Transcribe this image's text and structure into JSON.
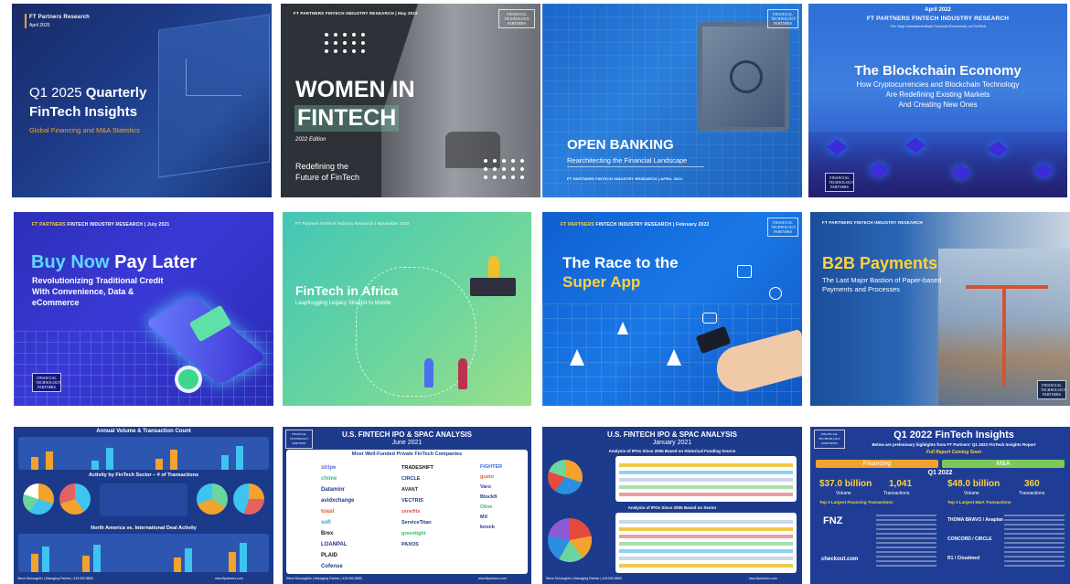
{
  "tiles": [
    {
      "id": "q1-2025",
      "super": "FT Partners Research",
      "date": "April 2025",
      "title_light": "Q1 2025 ",
      "title_bold": "Quarterly",
      "title_line2": "FinTech Insights",
      "subtitle": "Global Financing and M&A Statistics"
    },
    {
      "id": "women-in-fintech",
      "super": "FT PARTNERS FINTECH INDUSTRY RESEARCH | May 2022",
      "title_line1": "WOMEN IN",
      "title_line2": "FINTECH",
      "edition": "2022 Edition",
      "tagline_line1": "Redefining the",
      "tagline_line2": "Future of FinTech",
      "logo": "FINANCIAL TECHNOLOGY PARTNERS"
    },
    {
      "id": "open-banking",
      "title": "OPEN BANKING",
      "subtitle": "Rearchitecting the Financial Landscape",
      "footer": "FT PARTNERS FINTECH INDUSTRY RESEARCH | APRIL 2021",
      "logo": "FINANCIAL TECHNOLOGY PARTNERS"
    },
    {
      "id": "blockchain-economy",
      "date": "April 2022",
      "super": "FT PARTNERS FINTECH INDUSTRY RESEARCH",
      "super_sub": "The Only Investment Bank Focused Exclusively on FinTech",
      "title": "The Blockchain Economy",
      "subtitle_line1": "How Cryptocurrencies and Blockchain Technology",
      "subtitle_line2": "Are Redefining Existing Markets",
      "subtitle_line3": "And Creating New Ones",
      "logo": "FINANCIAL TECHNOLOGY PARTNERS"
    },
    {
      "id": "bnpl",
      "super_accent": "FT PARTNERS",
      "super": " FINTECH INDUSTRY RESEARCH | July 2021",
      "title_word1": "Buy Now ",
      "title_word2": "Pay Later",
      "subtitle_line1": "Revolutionizing Traditional Credit",
      "subtitle_line2": "With Convenience, Data &",
      "subtitle_line3": "eCommerce",
      "logo": "FINANCIAL TECHNOLOGY PARTNERS"
    },
    {
      "id": "fintech-africa",
      "super": "FT Partners FinTech Industry Research | November 2019",
      "title": "FinTech in Africa",
      "subtitle": "Leapfrogging Legacy Straight to Mobile"
    },
    {
      "id": "super-app",
      "super_accent": "FT PARTNERS",
      "super": " FINTECH INDUSTRY RESEARCH | February 2022",
      "title_line1": "The Race to the",
      "title_line2": "Super App",
      "logo": "FINANCIAL TECHNOLOGY PARTNERS"
    },
    {
      "id": "b2b-payments",
      "super": "FT PARTNERS FINTECH INDUSTRY RESEARCH",
      "title": "B2B Payments",
      "subtitle_line1": "The Last Major Bastion of Paper-based",
      "subtitle_line2": "Payments and Processes",
      "logo": "FINANCIAL TECHNOLOGY PARTNERS"
    },
    {
      "id": "volume-count",
      "title": "Annual Volume & Transaction Count",
      "section1": "Activity by FinTech Sector – # of Transactions",
      "section2": "North America vs. International Deal Activity",
      "footer_left": "Steve McLaughlin | Managing Partner | 415.992.8880",
      "footer_right": "www.ftpartners.com"
    },
    {
      "id": "ipo-spac-june",
      "title": "U.S. FINTECH IPO & SPAC ANALYSIS",
      "date": "June 2021",
      "subtitle": "Most Well-Funded Private FinTech Companies",
      "col1": [
        "stripe",
        "chime",
        "Dataminr",
        "avidxchange",
        "toast",
        "sofi",
        "Brex",
        "LOANPAL",
        "PLAID",
        "Cofense"
      ],
      "col2": [
        "TRADESHIFT",
        "CIRCLE",
        "",
        "AVANT",
        "VECTRIS",
        "zenefits",
        "ServiceTitan",
        "",
        "greenlight",
        "PAXOS"
      ],
      "col3": [
        "FIGHTER",
        "gusto",
        "",
        "Varo",
        "",
        "",
        "Blockfi",
        "",
        "Olive",
        "MX",
        "knock"
      ],
      "footer_left": "Steve McLaughlin | Managing Partner | 415.992.8880",
      "footer_right": "www.ftpartners.com"
    },
    {
      "id": "ipo-spac-jan",
      "title": "U.S. FINTECH IPO & SPAC ANALYSIS",
      "date": "January 2021",
      "section1": "Analysis of IPOs Since 2005 Based on Historical Funding Source",
      "section2": "Analysis of IPOs Since 2005 Based on Sector",
      "footer_left": "Steve McLaughlin | Managing Partner | 415.992.8880",
      "footer_right": "www.ftpartners.com"
    },
    {
      "id": "q1-2022",
      "title": "Q1 2022 FinTech Insights",
      "subtitle": "Below are preliminary highlights from FT Partners' Q1 2022 FinTech Insights Report",
      "coming": "Full Report Coming Soon",
      "tab_left": "Financing",
      "tab_right": "M&A",
      "quarter": "Q1 2022",
      "fin_volume": "$37.0 billion",
      "fin_volume_label": "Volume",
      "fin_count": "1,041",
      "fin_count_label": "Transactions",
      "ma_volume": "$48.0 billion",
      "ma_volume_label": "Volume",
      "ma_count": "360",
      "ma_count_label": "Transactions",
      "fin_top": "Top 3 Largest Financing Transactions",
      "ma_top": "Top 3 Largest M&A Transactions",
      "fin_cos": [
        "FNZ",
        "",
        "checkout.com"
      ],
      "ma_cos": [
        "THOMA BRAVO / Anaplan",
        "CONCORD / CIRCLE",
        "R1 / Cloudmed"
      ],
      "logo": "FINANCIAL TECHNOLOGY PARTNERS"
    }
  ]
}
